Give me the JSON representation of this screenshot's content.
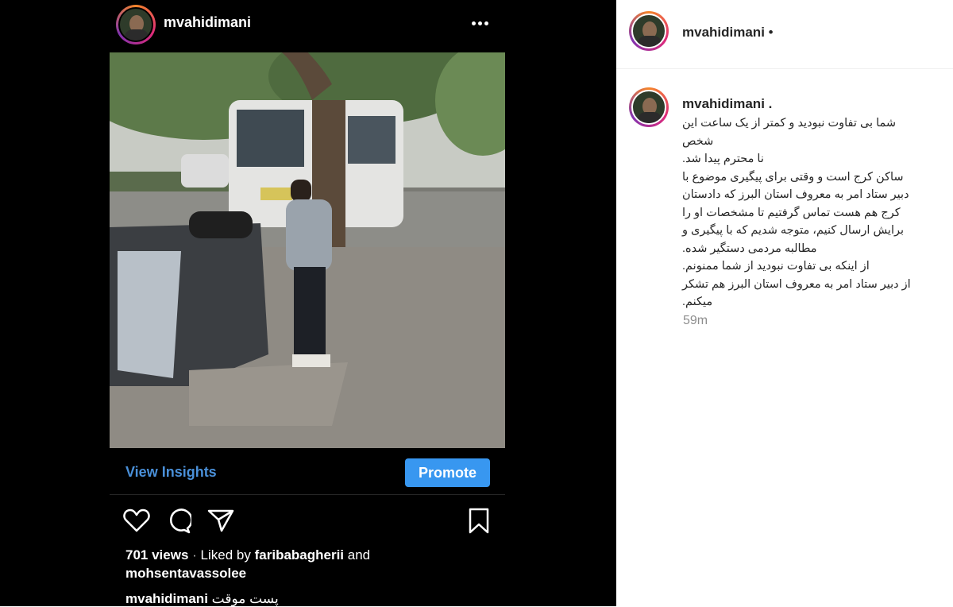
{
  "left_post": {
    "header": {
      "username": "mvahidimani",
      "more_label": "•••"
    },
    "actions": {
      "view_insights": "View Insights",
      "promote": "Promote"
    },
    "stats": {
      "views": "701 views",
      "separator": "·",
      "liked_by_prefix": "Liked by",
      "liked_user_1": "faribabagherii",
      "and": "and",
      "liked_user_2": "mohsentavassolee"
    },
    "caption": {
      "username": "mvahidimani",
      "text": "پست موقت"
    }
  },
  "right_panel": {
    "header": {
      "username": "mvahidimani",
      "dot": "•"
    },
    "comment": {
      "username": "mvahidimani .",
      "lines": [
        "شما بی تفاوت نبودید و کمتر از یک ساعت این شخص",
        "نا محترم پیدا شد.",
        "ساکن کرج است و وقتی برای پیگیری موضوع با",
        "دبیر ستاد امر به معروف استان البرز که دادستان",
        "کرج هم هست تماس گرفتیم تا مشخصات او را",
        "برایش ارسال کنیم، متوجه شدیم که با پیگیری و",
        "مطالبه مردمی دستگیر شده.",
        "از اینکه بی تفاوت نبودید از شما ممنونم.",
        "از دبیر ستاد امر به معروف استان البرز هم تشکر",
        "میکنم."
      ],
      "timestamp": "59m"
    }
  },
  "colors": {
    "promote_bg": "#3897f0",
    "insights_text": "#4a90d9",
    "timestamp": "#8e8e8e"
  }
}
